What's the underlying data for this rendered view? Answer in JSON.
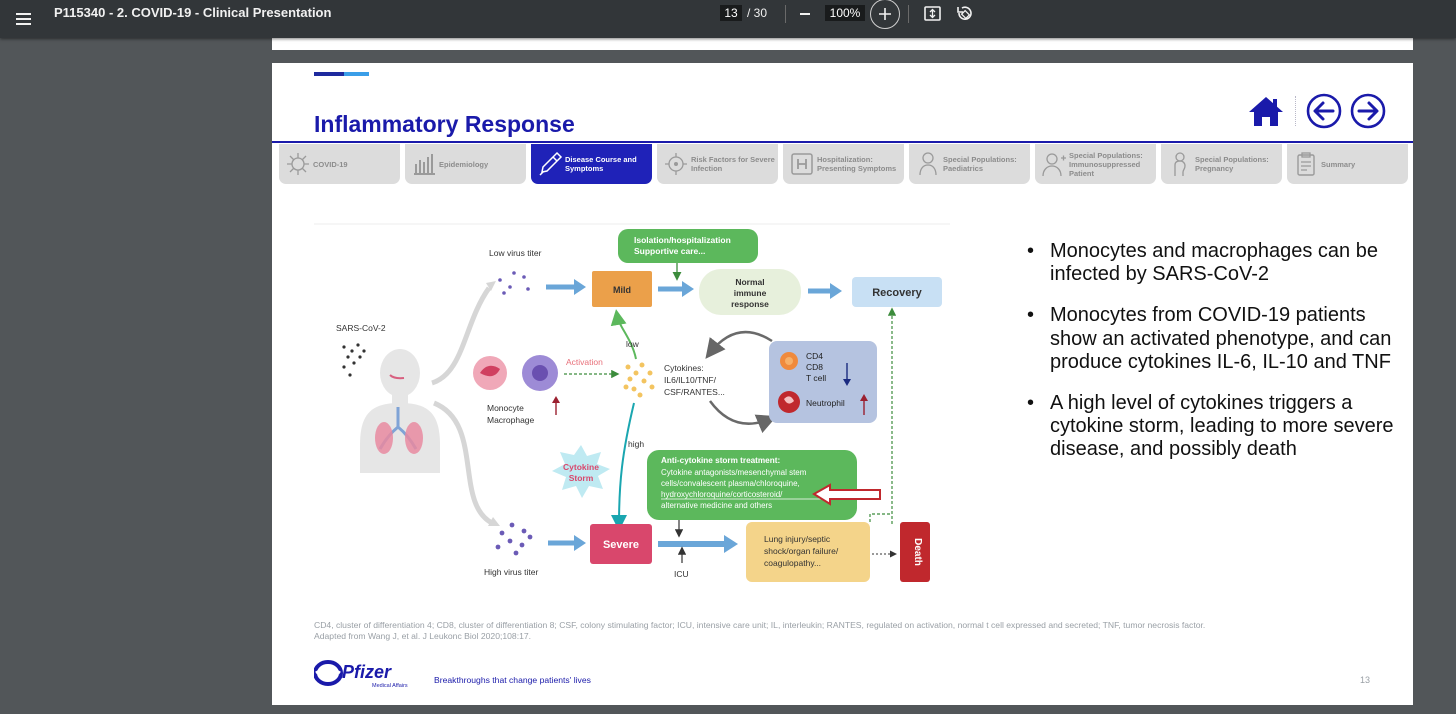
{
  "viewer": {
    "doc_title": "P115340 - 2. COVID-19 - Clinical Presentation",
    "page_current": "13",
    "page_total": "/ 30",
    "zoom": "100%"
  },
  "slide": {
    "title": "Inflammatory Response",
    "tabs": [
      {
        "label": "COVID-19",
        "icon": "virus-icon",
        "active": false
      },
      {
        "label": "Epidemiology",
        "icon": "bar-chart-icon",
        "active": false
      },
      {
        "label": "Disease Course and Symptoms",
        "icon": "thermometer-icon",
        "active": true
      },
      {
        "label": "Risk Factors for Severe Infection",
        "icon": "virus-icon",
        "active": false
      },
      {
        "label": "Hospitalization: Presenting Symptoms",
        "icon": "hospital-icon",
        "active": false
      },
      {
        "label": "Special Populations: Paediatrics",
        "icon": "baby-icon",
        "active": false
      },
      {
        "label": "Special Populations: Immunosuppressed Patient",
        "icon": "patient-icon",
        "active": false
      },
      {
        "label": "Special Populations: Pregnancy",
        "icon": "pregnancy-icon",
        "active": false
      },
      {
        "label": "Summary",
        "icon": "clipboard-icon",
        "active": false
      }
    ],
    "diagram": {
      "low_titer": "Low virus titer",
      "high_titer": "High virus titer",
      "sars": "SARS-CoV-2",
      "isolation_1": "Isolation/hospitalization",
      "isolation_2": "Supportive care...",
      "mild": "Mild",
      "normal_1": "Normal",
      "normal_2": "immune",
      "normal_3": "response",
      "recovery": "Recovery",
      "low": "low",
      "high": "high",
      "activation": "Activation",
      "monocyte": "Monocyte",
      "macrophage": "Macrophage",
      "cyto_1": "Cytokines:",
      "cyto_2": "IL6/IL10/TNF/",
      "cyto_3": "CSF/RANTES...",
      "cd4": "CD4",
      "cd8": "CD8",
      "tcell": "T cell",
      "neutrophil": "Neutrophil",
      "storm_1": "Cytokine",
      "storm_2": "Storm",
      "anti_title": "Anti-cytokine storm treatment:",
      "anti_1": "Cytokine antagonists/mesenchymal stem",
      "anti_2": "cells/convalescent plasma/chloroquine,",
      "anti_3": "hydroxychloroquine/corticosteroid/",
      "anti_4": "alternative medicine and others",
      "severe": "Severe",
      "icu": "ICU",
      "lung_1": "Lung injury/septic",
      "lung_2": "shock/organ failure/",
      "lung_3": "coagulopathy...",
      "death": "Death"
    },
    "bullets": [
      "Monocytes and macrophages can be infected by SARS-CoV-2",
      "Monocytes from COVID-19 patients show an activated phenotype, and can produce cytokines IL-6, IL-10 and TNF",
      "A high level of cytokines triggers a cytokine storm, leading to more severe disease, and possibly death"
    ],
    "footnote_1": "CD4, cluster of differentiation 4; CD8, cluster of differentiation 8; CSF, colony stimulating factor; ICU, intensive care unit; IL, interleukin; RANTES, regulated on activation, normal t cell expressed and secreted; TNF, tumor necrosis factor.",
    "footnote_2": "Adapted from Wang J, et al. J Leukonc Biol 2020;108:17.",
    "brand": "Pfizer",
    "brand_sub": "Medical Affairs",
    "tagline": "Breakthroughs that change patients' lives",
    "page_number": "13"
  },
  "colors": {
    "toolbar": "#323639",
    "background": "#525659",
    "title_blue": "#1a1aaa",
    "tab_active": "#1f22b8",
    "mild_orange": "#eba04a",
    "severe_pink": "#d9476c",
    "death_red": "#c0282d",
    "green_box": "#5cb85c",
    "arrow_blue": "#6aa6d8"
  }
}
